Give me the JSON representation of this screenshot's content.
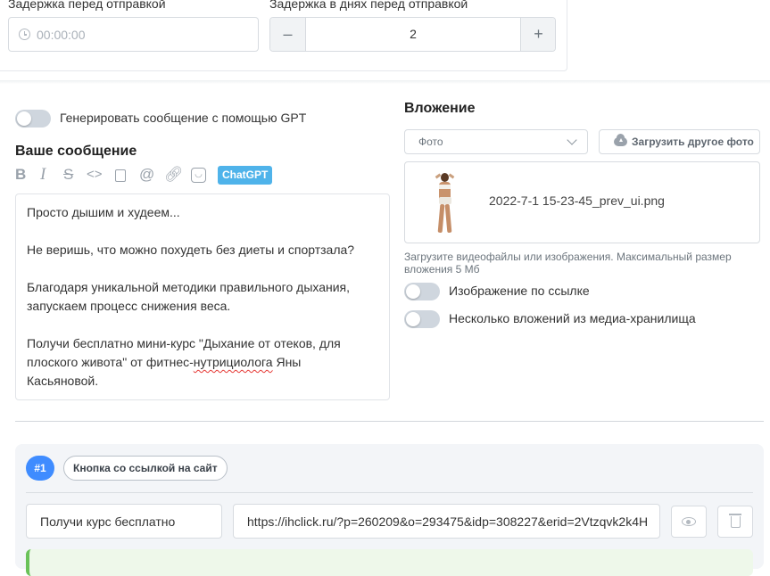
{
  "delay": {
    "label": "Задержка перед отправкой",
    "placeholder": "00:00:00"
  },
  "delay_days": {
    "label": "Задержка в днях перед отправкой",
    "minus": "–",
    "plus": "+",
    "value": "2"
  },
  "gpt_toggle": {
    "label": "Генерировать сообщение с помощью GPT",
    "on": false
  },
  "message": {
    "heading": "Ваше сообщение",
    "chatgpt_label": "ChatGPT",
    "lines": [
      "Просто дышим и худеем...",
      "",
      "Не веришь, что можно похудеть без диеты и спортзала?",
      "",
      "Благодаря уникальной методики правильного дыхания,",
      "запускаем процесс снижения веса.",
      "",
      "Получи бесплатно мини-курс \"Дыхание от отеков, для",
      "плоского живота\" от фитнес-",
      "Касьяновой."
    ],
    "line8_misspelled": "нутрициолога",
    "line8_tail": " Яны"
  },
  "attachment": {
    "heading": "Вложение",
    "type_select": "Фото",
    "upload_button": "Загрузить другое фото",
    "file_name": "2022-7-1 15-23-45_prev_ui.png",
    "hint": "Загрузите видеофайлы или изображения. Максимальный размер вложения 5 Мб",
    "hint_line1": "Загрузите видеофайлы или изображения. Максимальный размер",
    "hint_line2": "вложения 5 Мб",
    "toggle_url_label": "Изображение по ссылке",
    "toggle_media_label": "Несколько вложений из медиа-хранилища"
  },
  "buttons_block": {
    "badge": "#1",
    "type_label": "Кнопка со ссылкой на сайт",
    "button_text": "Получи курс бесплатно",
    "url": "https://ihclick.ru/?p=260209&o=293475&idp=308227&erid=2Vtzqvk2k4H"
  },
  "colors": {
    "accent": "#3f8cff",
    "chatgpt": "#4fb3ea",
    "toggle_off": "#cfd6de",
    "success_strip": "#6ac259"
  }
}
